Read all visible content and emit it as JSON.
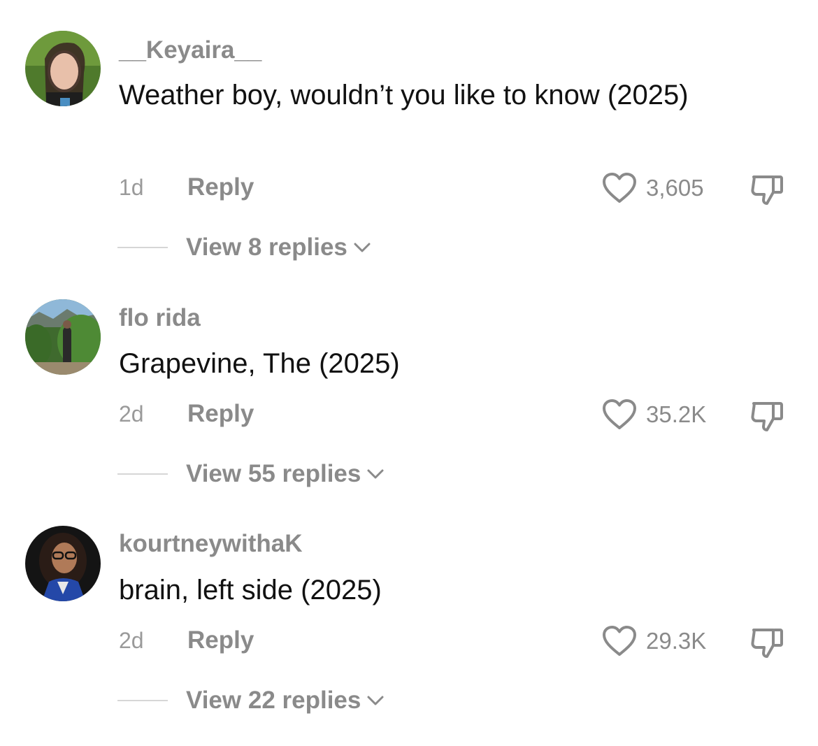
{
  "comments": [
    {
      "username": "__Keyaira__",
      "text": "Weather boy, wouldn’t you like to know (2025)",
      "time": "1d",
      "reply_label": "Reply",
      "likes": "3,605",
      "view_replies": "View 8 replies"
    },
    {
      "username": "flo rida",
      "text": "Grapevine, The (2025)",
      "time": "2d",
      "reply_label": "Reply",
      "likes": "35.2K",
      "view_replies": "View 55 replies"
    },
    {
      "username": "kourtneywithaK",
      "text": "brain, left side (2025)",
      "time": "2d",
      "reply_label": "Reply",
      "likes": "29.3K",
      "view_replies": "View 22 replies"
    }
  ],
  "icons": {
    "like": "heart-outline-icon",
    "dislike": "thumbs-down-outline-icon",
    "expand": "chevron-down-icon"
  },
  "colors": {
    "text_primary": "#111111",
    "text_secondary": "#8a8a8a",
    "background": "#ffffff"
  }
}
